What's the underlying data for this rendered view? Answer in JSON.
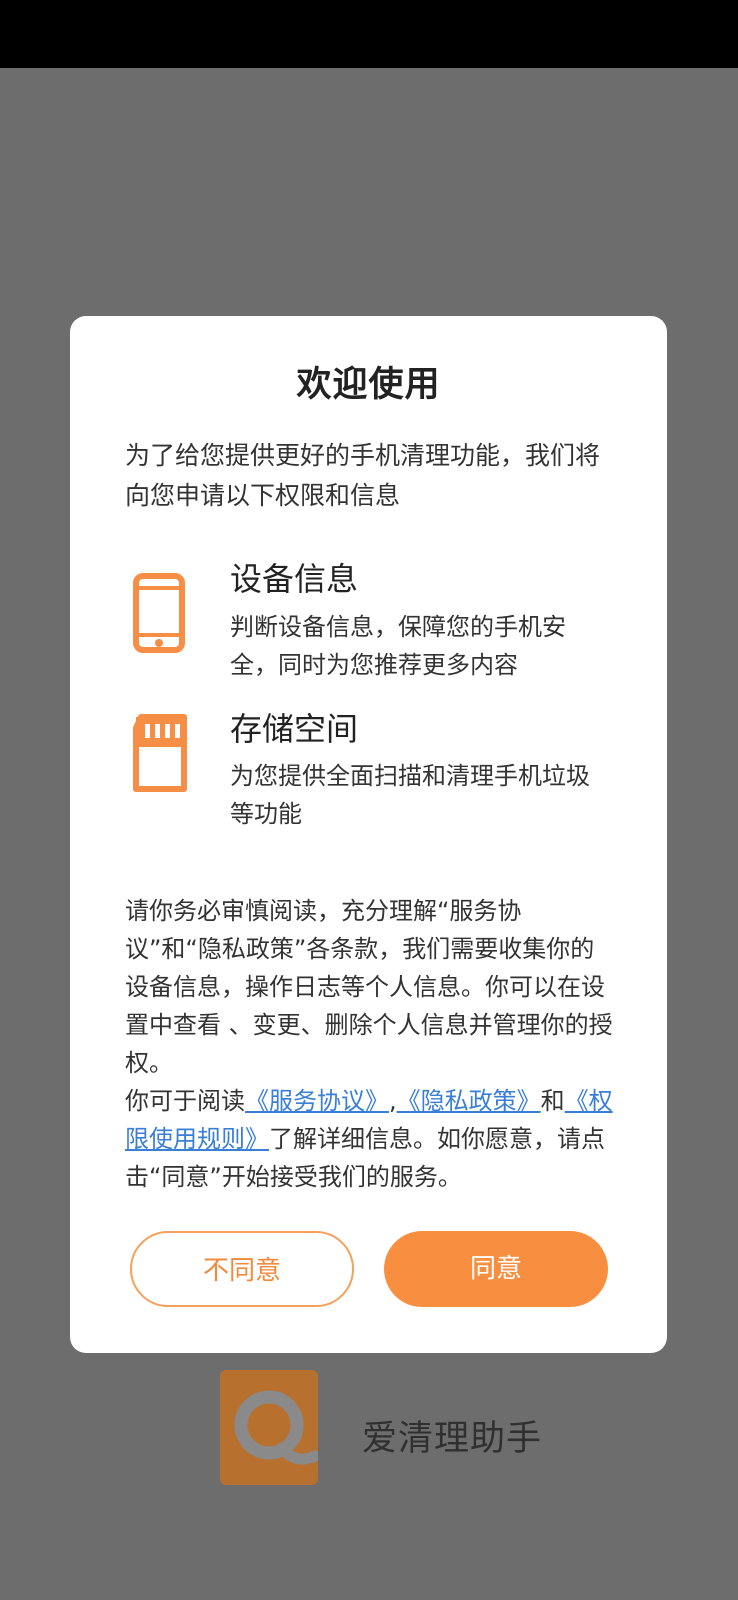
{
  "dialog": {
    "title": "欢迎使用",
    "intro": "为了给您提供更好的手机清理功能，我们将向您申请以下权限和信息",
    "permissions": [
      {
        "icon": "phone-icon",
        "title": "设备信息",
        "desc": "判断设备信息，保障您的手机安全，同时为您推荐更多内容"
      },
      {
        "icon": "sd-card-icon",
        "title": "存储空间",
        "desc": "为您提供全面扫描和清理手机垃圾等功能"
      }
    ],
    "notice_p1": "请你务必审慎阅读，充分理解“服务协议”和“隐私政策”各条款，我们需要收集你的设备信息，操作日志等个人信息。你可以在设置中查看 、变更、删除个人信息并管理你的授权。",
    "notice_p2_prefix": "你可于阅读",
    "link_service": "《服务协议》",
    "sep_comma": ",",
    "link_privacy": "《隐私政策》",
    "and_text": "和",
    "link_permission": "《权限使用规则》",
    "notice_p2_suffix": "了解详细信息。如你愿意，请点击“同意”开始接受我们的服务。",
    "disagree_label": "不同意",
    "agree_label": "同意"
  },
  "background": {
    "app_name": "爱清理助手"
  },
  "colors": {
    "accent": "#f88f40",
    "link": "#3a7fd6",
    "overlay": "#6d6d6d"
  }
}
